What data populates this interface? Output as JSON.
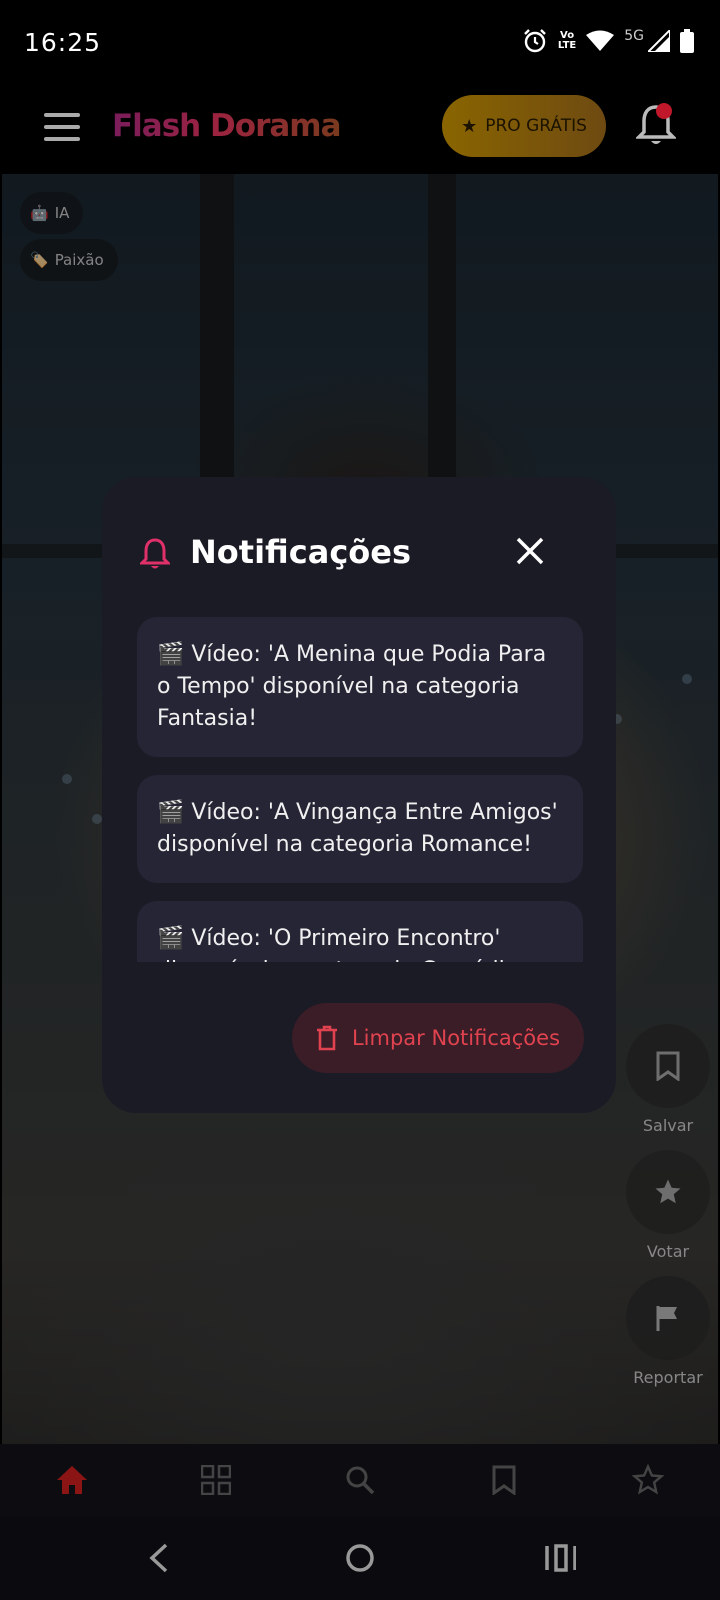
{
  "status_bar": {
    "time": "16:25",
    "lte_top": "Vo",
    "lte_bottom": "LTE",
    "network": "5G"
  },
  "header": {
    "app_title": "Flash Dorama",
    "pro_button_label": "PRO GRÁTIS",
    "colors": {
      "pro_gradient_start": "#8a6500",
      "notification_dot": "#c0182a"
    }
  },
  "video": {
    "tags": [
      {
        "icon": "robot-icon",
        "label": "IA"
      },
      {
        "icon": "tag-icon",
        "label": "Paixão"
      }
    ],
    "actions": [
      {
        "icon": "bookmark-icon",
        "label": "Salvar"
      },
      {
        "icon": "star-icon",
        "label": "Votar"
      },
      {
        "icon": "flag-icon",
        "label": "Reportar"
      }
    ]
  },
  "notifications_dialog": {
    "title": "Notificações",
    "items": [
      "🎬 Vídeo: 'A Menina que Podia Para o Tempo' disponível na categoria Fantasia!",
      "🎬 Vídeo: 'A Vingança Entre Amigos' disponível na categoria Romance!",
      "🎬 Vídeo: 'O Primeiro Encontro' disponível na categoria Comédia"
    ],
    "clear_button_label": "Limpar Notificações",
    "colors": {
      "accent": "#e0434f",
      "bell": "#e0306a"
    }
  },
  "bottom_nav": {
    "items": [
      "home-icon",
      "grid-icon",
      "search-icon",
      "bookmark-icon",
      "star-icon"
    ],
    "active_color": "#8b1414"
  }
}
